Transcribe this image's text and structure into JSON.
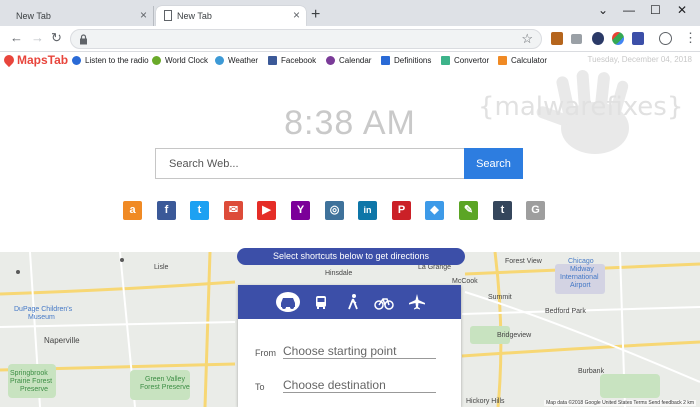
{
  "tabs": [
    {
      "title": "New Tab",
      "active": false
    },
    {
      "title": "New Tab",
      "active": true
    }
  ],
  "window_controls": {
    "collapse": "⌄",
    "minimize": "—",
    "maximize": "☐",
    "close": "✕"
  },
  "bookmarks": {
    "logo": "MapsTab",
    "items": [
      {
        "label": "Listen to the radio",
        "icon": "radio-icon",
        "color": "#2a6ad6"
      },
      {
        "label": "World Clock",
        "icon": "clock-icon",
        "color": "#6aaa2a"
      },
      {
        "label": "Weather",
        "icon": "weather-icon",
        "color": "#3d9ad6"
      },
      {
        "label": "Facebook",
        "icon": "facebook-icon",
        "color": "#3b5998"
      },
      {
        "label": "Calendar",
        "icon": "calendar-icon",
        "color": "#7a3b98"
      },
      {
        "label": "Definitions",
        "icon": "definitions-icon",
        "color": "#2a6ad6"
      },
      {
        "label": "Convertor",
        "icon": "convertor-icon",
        "color": "#3db38a"
      },
      {
        "label": "Calculator",
        "icon": "calculator-icon",
        "color": "#f08a24"
      }
    ],
    "date": "Tuesday, December 04, 2018"
  },
  "clock": "8:38 AM",
  "watermark": "{malwarefixes}",
  "search": {
    "placeholder": "Search Web...",
    "button": "Search"
  },
  "shortcuts": [
    {
      "name": "amazon-icon",
      "glyph": "a",
      "color": "#f08a24"
    },
    {
      "name": "facebook-icon",
      "glyph": "f",
      "color": "#3b5998"
    },
    {
      "name": "twitter-icon",
      "glyph": "t",
      "color": "#1da1f2"
    },
    {
      "name": "mail-icon",
      "glyph": "✉",
      "color": "#dd4b39"
    },
    {
      "name": "youtube-icon",
      "glyph": "▶",
      "color": "#e52d27"
    },
    {
      "name": "yahoo-icon",
      "glyph": "Y",
      "color": "#7b0099"
    },
    {
      "name": "instagram-icon",
      "glyph": "◎",
      "color": "#3f729b"
    },
    {
      "name": "linkedin-icon",
      "glyph": "in",
      "color": "#0e76a8"
    },
    {
      "name": "pinterest-icon",
      "glyph": "P",
      "color": "#cb2027"
    },
    {
      "name": "dropbox-icon",
      "glyph": "◆",
      "color": "#3d9ae8"
    },
    {
      "name": "evernote-icon",
      "glyph": "✎",
      "color": "#5ba525"
    },
    {
      "name": "tumblr-icon",
      "glyph": "t",
      "color": "#35465c"
    },
    {
      "name": "google-icon",
      "glyph": "G",
      "color": "#9e9e9e"
    }
  ],
  "directions": {
    "banner": "Select shortcuts below to get directions",
    "from_label": "From",
    "from_placeholder": "Choose starting point",
    "to_label": "To",
    "to_placeholder": "Choose destination"
  },
  "map_labels": [
    {
      "text": "Lisle"
    },
    {
      "text": "DuPage Children's"
    },
    {
      "text": "Museum"
    },
    {
      "text": "Naperville"
    },
    {
      "text": "Springbrook"
    },
    {
      "text": "Prairie Forest"
    },
    {
      "text": "Preserve"
    },
    {
      "text": "Green Valley"
    },
    {
      "text": "Forest Preserve"
    },
    {
      "text": "Hinsdale"
    },
    {
      "text": "La Grange"
    },
    {
      "text": "McCook"
    },
    {
      "text": "Forest View"
    },
    {
      "text": "Chicago"
    },
    {
      "text": "Midway"
    },
    {
      "text": "International"
    },
    {
      "text": "Airport"
    },
    {
      "text": "Summit"
    },
    {
      "text": "Bedford Park"
    },
    {
      "text": "Bridgeview"
    },
    {
      "text": "Burbank"
    },
    {
      "text": "Hickory Hills"
    }
  ],
  "map_attribution": "Map data ©2018 Google   United States   Terms   Send feedback   2 km"
}
